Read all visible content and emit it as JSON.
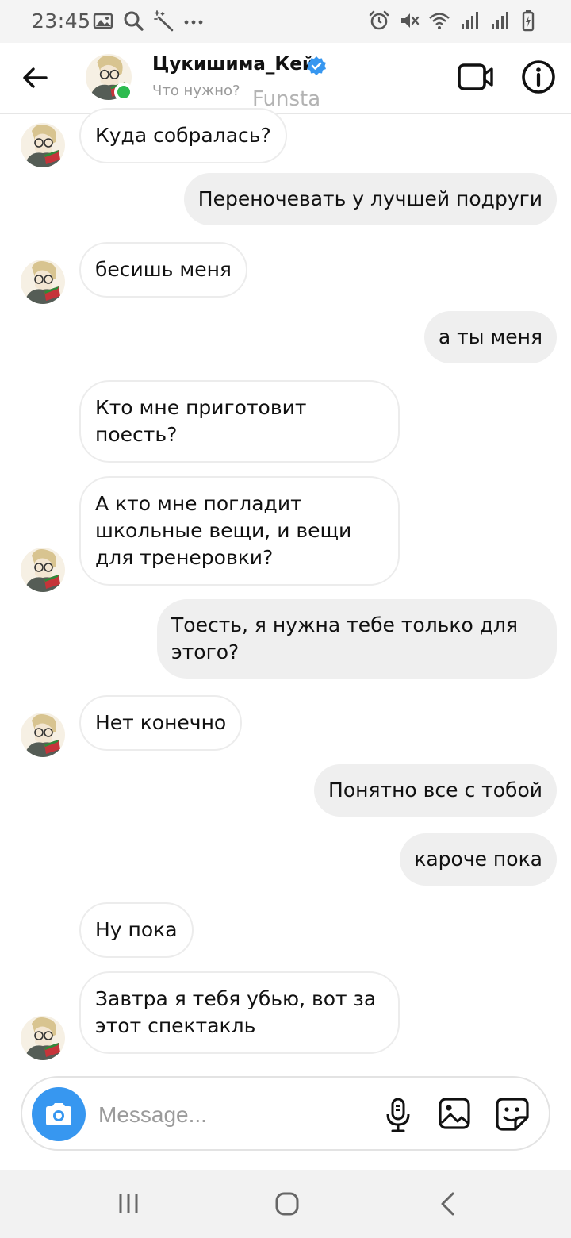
{
  "status_bar": {
    "time": "23:45",
    "left_icons": [
      "image-icon",
      "search-icon",
      "magic-wand-icon",
      "more-dots-icon"
    ],
    "right_icons": [
      "alarm-icon",
      "mute-icon",
      "wifi-icon",
      "signal-icon",
      "signal-icon",
      "battery-icon"
    ]
  },
  "header": {
    "username": "Цукишима_Кей",
    "status_text": "Что нужно?",
    "account_label": "Funsta",
    "verified": true,
    "online": true,
    "accent_color": "#3797f0",
    "online_color": "#2dbb4f"
  },
  "messages": [
    {
      "side": "in",
      "text": "Куда собралась?",
      "show_avatar": true
    },
    {
      "side": "out",
      "text": "Переночевать у лучшей подруги"
    },
    {
      "side": "in",
      "text": "бесишь меня",
      "show_avatar": true
    },
    {
      "side": "out",
      "text": "а ты меня"
    },
    {
      "side": "in",
      "text": "Кто мне приготовит поесть?",
      "show_avatar": false
    },
    {
      "side": "in",
      "text": "А кто мне погладит школьные вещи, и вещи для тренеровки?",
      "show_avatar": true
    },
    {
      "side": "out",
      "text": "Тоесть, я нужна тебе только для этого?"
    },
    {
      "side": "in",
      "text": "Нет конечно",
      "show_avatar": true
    },
    {
      "side": "out",
      "text": "Понятно все с тобой"
    },
    {
      "side": "out",
      "text": "кароче пока"
    },
    {
      "side": "in",
      "text": "Ну пока",
      "show_avatar": false
    },
    {
      "side": "in",
      "text": "Завтра я тебя убью, вот за этот спектакль",
      "show_avatar": true
    }
  ],
  "composer": {
    "placeholder": "Message...",
    "buttons": [
      "camera-icon",
      "microphone-icon",
      "gallery-icon",
      "sticker-icon"
    ]
  },
  "nav_bar": {
    "buttons": [
      "recent-apps-icon",
      "home-icon",
      "back-icon"
    ]
  }
}
